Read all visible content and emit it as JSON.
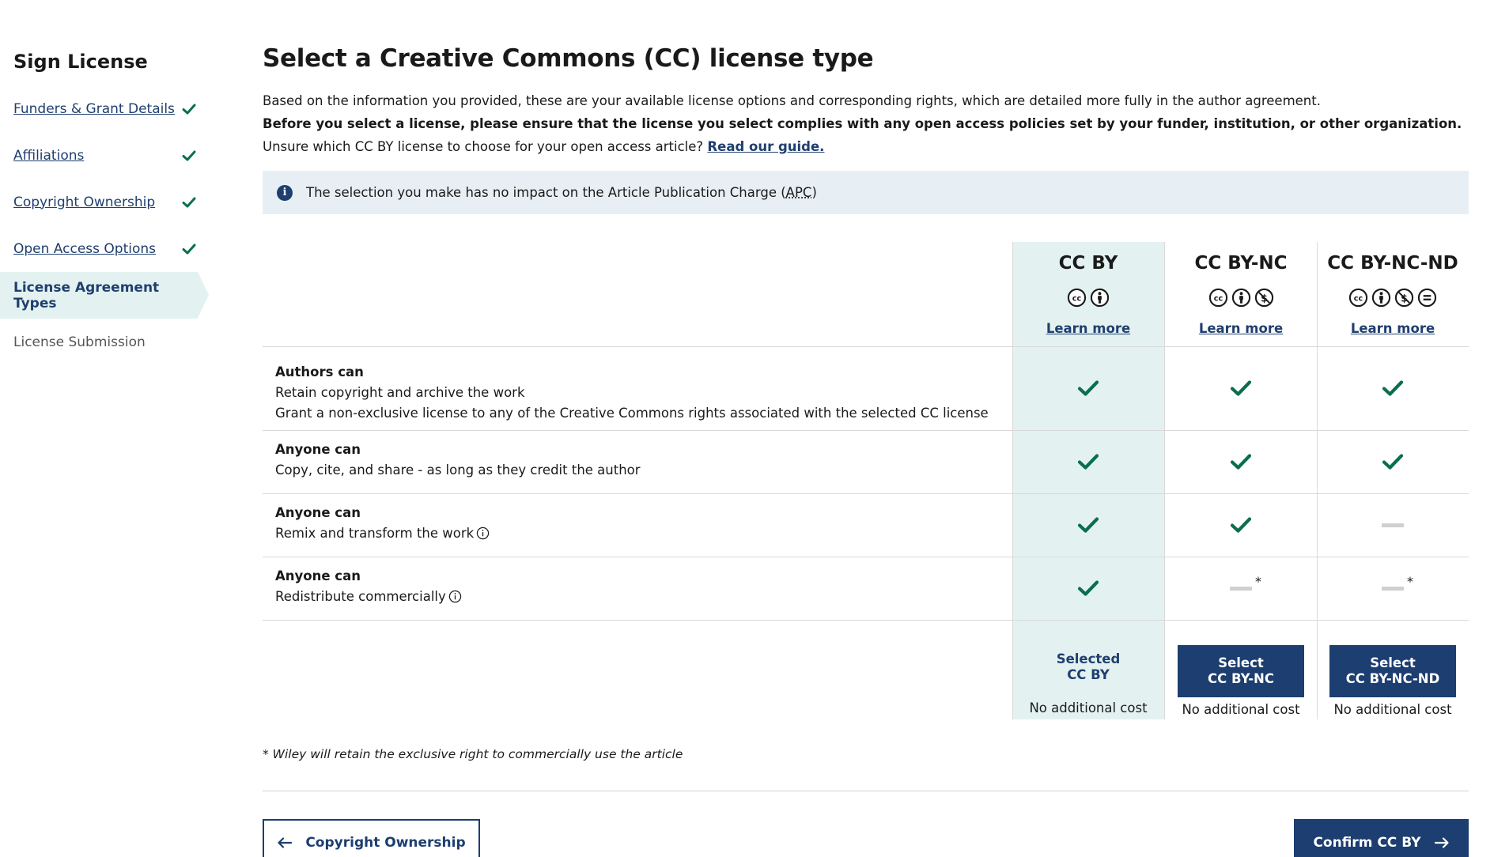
{
  "sidebar": {
    "title": "Sign License",
    "steps": [
      {
        "label": "Funders & Grant Details",
        "status": "done"
      },
      {
        "label": "Affiliations",
        "status": "done"
      },
      {
        "label": "Copyright Ownership",
        "status": "done"
      },
      {
        "label": "Open Access Options",
        "status": "done"
      },
      {
        "label": "License Agreement Types",
        "status": "current"
      },
      {
        "label": "License Submission",
        "status": "pending"
      }
    ]
  },
  "main": {
    "title": "Select a Creative Commons (CC) license type",
    "intro_line1": "Based on the information you provided, these are your available license options and corresponding rights, which are detailed more fully in the author agreement.",
    "intro_line2": "Before you select a license, please ensure that the license you select complies with any open access policies set by your funder, institution, or other organization.",
    "intro_line3_prefix": "Unsure which CC BY license to choose for your open access article?",
    "intro_line3_link": "Read our guide.",
    "info_text_prefix": "The selection you make has no impact on the Article Publication Charge (",
    "info_abbr": "APC",
    "info_text_suffix": ")"
  },
  "licenses": [
    {
      "name": "CC BY",
      "icons": [
        "cc-icon",
        "by-icon"
      ],
      "learn_more": "Learn more",
      "selected": true,
      "action_line1": "Selected",
      "action_line2": "CC BY",
      "cost": "No additional cost"
    },
    {
      "name": "CC BY-NC",
      "icons": [
        "cc-icon",
        "by-icon",
        "nc-icon"
      ],
      "learn_more": "Learn more",
      "selected": false,
      "action_line1": "Select",
      "action_line2": "CC BY-NC",
      "cost": "No additional cost"
    },
    {
      "name": "CC BY-NC-ND",
      "icons": [
        "cc-icon",
        "by-icon",
        "nc-icon",
        "nd-icon"
      ],
      "learn_more": "Learn more",
      "selected": false,
      "action_line1": "Select",
      "action_line2": "CC BY-NC-ND",
      "cost": "No additional cost"
    }
  ],
  "rights": [
    {
      "title": "Authors can",
      "lines": [
        "Retain copyright and archive the work",
        "Grant a non-exclusive license to any of the Creative Commons rights associated with the selected CC license"
      ],
      "tooltip": false,
      "values": [
        "check",
        "check",
        "check"
      ]
    },
    {
      "title": "Anyone can",
      "lines": [
        "Copy, cite, and share - as long as they credit the author"
      ],
      "tooltip": false,
      "values": [
        "check",
        "check",
        "check"
      ]
    },
    {
      "title": "Anyone can",
      "lines": [
        "Remix and transform the work"
      ],
      "tooltip": true,
      "values": [
        "check",
        "check",
        "dash"
      ]
    },
    {
      "title": "Anyone can",
      "lines": [
        "Redistribute commercially"
      ],
      "tooltip": true,
      "values": [
        "check",
        "dash-star",
        "dash-star"
      ]
    }
  ],
  "footnote": "* Wiley will retain the exclusive right to commercially use the article",
  "footnote_marker": "*",
  "buttons": {
    "back_label": "Copyright Ownership",
    "confirm_label": "Confirm CC BY"
  },
  "colors": {
    "brand_navy": "#1c3e70",
    "link_navy": "#1f3f6e",
    "check_green": "#0a6e4f",
    "highlight_teal": "#e3f2f1",
    "info_bg": "#e8eff4"
  }
}
